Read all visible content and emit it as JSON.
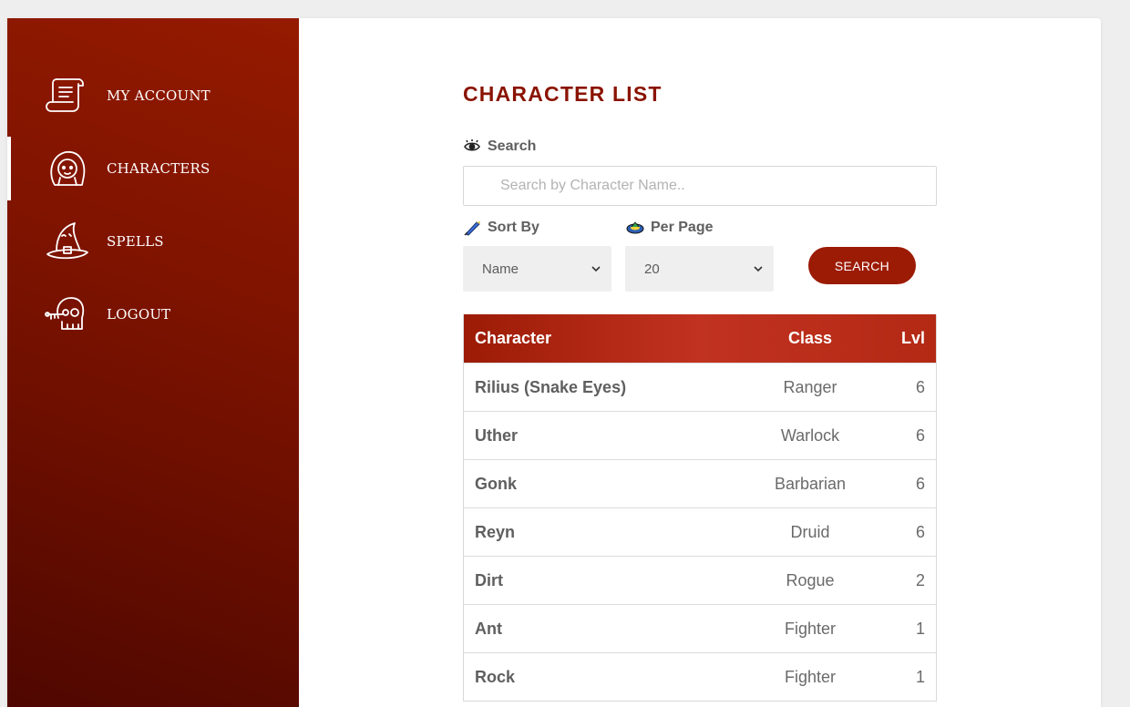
{
  "sidebar": {
    "items": [
      {
        "label": "My Account",
        "icon": "scroll-icon"
      },
      {
        "label": "Characters",
        "icon": "character-face-icon",
        "active": true
      },
      {
        "label": "Spells",
        "icon": "wizard-hat-icon"
      },
      {
        "label": "Logout",
        "icon": "skull-key-icon"
      }
    ]
  },
  "main": {
    "title": "CHARACTER LIST",
    "search": {
      "label": "Search",
      "icon": "eye-icon",
      "placeholder": "Search by Character Name.."
    },
    "sort": {
      "label": "Sort By",
      "icon": "quill-icon",
      "value": "Name"
    },
    "per_page": {
      "label": "Per Page",
      "icon": "potion-icon",
      "value": "20"
    },
    "search_button": "SEARCH",
    "table": {
      "headers": {
        "character": "Character",
        "class": "Class",
        "lvl": "Lvl"
      },
      "rows": [
        {
          "name": "Rilius (Snake Eyes)",
          "class": "Ranger",
          "lvl": "6"
        },
        {
          "name": "Uther",
          "class": "Warlock",
          "lvl": "6"
        },
        {
          "name": "Gonk",
          "class": "Barbarian",
          "lvl": "6"
        },
        {
          "name": "Reyn",
          "class": "Druid",
          "lvl": "6"
        },
        {
          "name": "Dirt",
          "class": "Rogue",
          "lvl": "2"
        },
        {
          "name": "Ant",
          "class": "Fighter",
          "lvl": "1"
        },
        {
          "name": "Rock",
          "class": "Fighter",
          "lvl": "1"
        }
      ]
    }
  },
  "colors": {
    "brand": "#8a1300",
    "sidebar_dark": "#4f0700",
    "button": "#9c1b05",
    "table_header": "#c13220"
  }
}
